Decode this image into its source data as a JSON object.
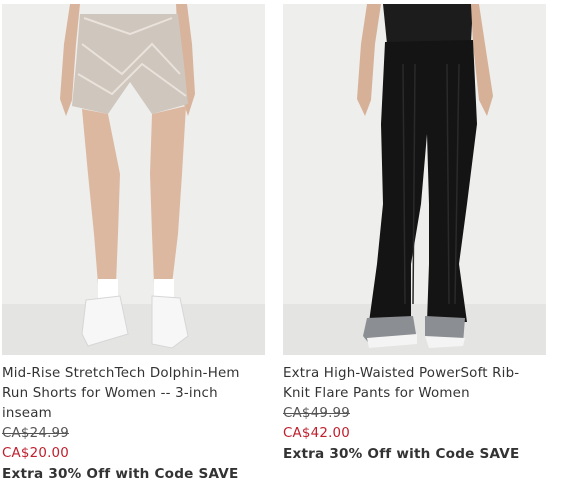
{
  "products": [
    {
      "title": "Mid-Rise StretchTech Dolphin-Hem Run Shorts for Women -- 3-inch inseam",
      "original_price": "CA$24.99",
      "sale_price": "CA$20.00",
      "promo": "Extra 30% Off with Code SAVE",
      "image_icon": "shorts-product-photo"
    },
    {
      "title": "Extra High-Waisted PowerSoft Rib-Knit Flare Pants for Women",
      "original_price": "CA$49.99",
      "sale_price": "CA$42.00",
      "promo": "Extra 30% Off with Code SAVE",
      "image_icon": "flare-pants-product-photo"
    }
  ],
  "colors": {
    "sale_price": "#c01f2d",
    "text": "#333333",
    "photo_background": "#ececec"
  }
}
